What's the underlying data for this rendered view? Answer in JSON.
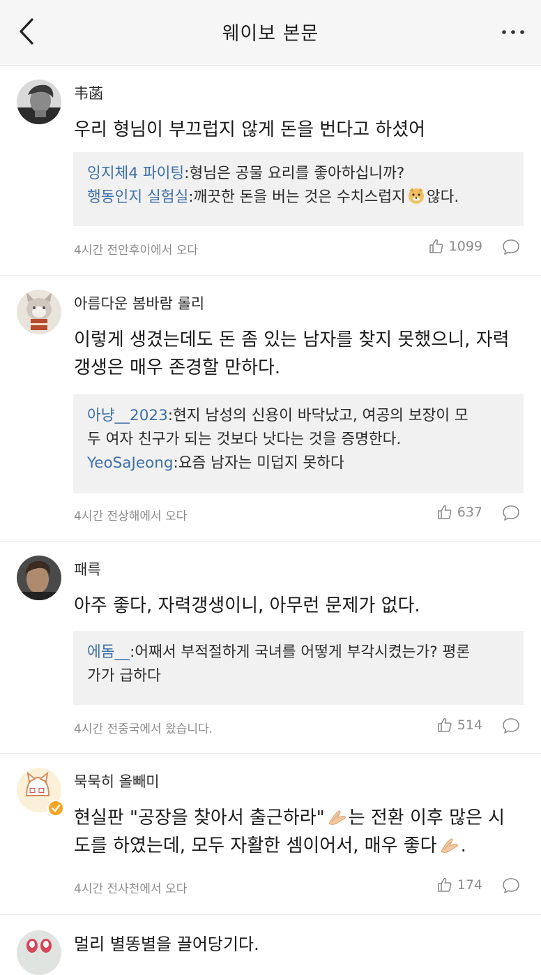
{
  "header": {
    "title": "웨이보 본문"
  },
  "comments": [
    {
      "user": "韦菡",
      "text": "우리 형님이 부끄럽지 않게 돈을 번다고 하셨어",
      "replies": [
        {
          "user": "잉지체4 파이팅",
          "text": ":형님은 공물 요리를 좋아하십니까?"
        },
        {
          "user": "행동인지 실험실",
          "text_a": ":깨끗한 돈을 버는 것은 수치스럽지",
          "text_b": "않다."
        }
      ],
      "time": "4시간 전안후이에서 오다",
      "likes": "1099"
    },
    {
      "user": "아름다운 봄바람 롤리",
      "text_lines": [
        "이렇게 생겼는데도 돈 좀 있는 남자를 찾지 못했으니, 자력",
        "갱생은 매우 존경할 만하다."
      ],
      "replies": [
        {
          "user": "아냥__2023",
          "text": ":현지 남성의 신용이 바닥났고, 여공의 보장이 모",
          "text_cont": "두 여자 친구가 되는 것보다 낫다는 것을 증명한다."
        },
        {
          "user": "YeoSaJeong",
          "text": ":요즘 남자는 미덥지 못하다"
        }
      ],
      "time": "4시간 전상해에서 오다",
      "likes": "637"
    },
    {
      "user": "패륵",
      "text": "아주 좋다, 자력갱생이니, 아무런 문제가 없다.",
      "replies": [
        {
          "user": "에돔__",
          "text": ":어째서 부적절하게 국녀를 어떻게 부각시켰는가? 평론",
          "text_cont": "가가 급하다"
        }
      ],
      "time": "4시간 전중국에서 왔습니다.",
      "likes": "514"
    },
    {
      "user": "묵묵히 올빼미",
      "text_a": "현실판 \"공장을 찾아서 출근하라\"",
      "text_b": "는 전환 이후 많은 시",
      "text_c": "도를 하였는데, 모두 자활한 셈이어서, 매우 좋다",
      "text_d": ".",
      "time": "4시간 전사천에서 오다",
      "likes": "174"
    },
    {
      "user": "멀리 별똥별을 끌어당기다."
    }
  ],
  "icons": {
    "back": "chevron-left-icon",
    "more": "more-dots-icon",
    "like": "thumbs-up-icon",
    "comment": "speech-bubble-icon",
    "emoji_doge": "doge-emoji-icon",
    "emoji_pray": "pray-hands-emoji-icon"
  },
  "colors": {
    "link": "#3d6fa8",
    "meta": "#8c8c8c",
    "reply_bg": "#f1f1f1",
    "header_bg": "#f6f6f6"
  }
}
